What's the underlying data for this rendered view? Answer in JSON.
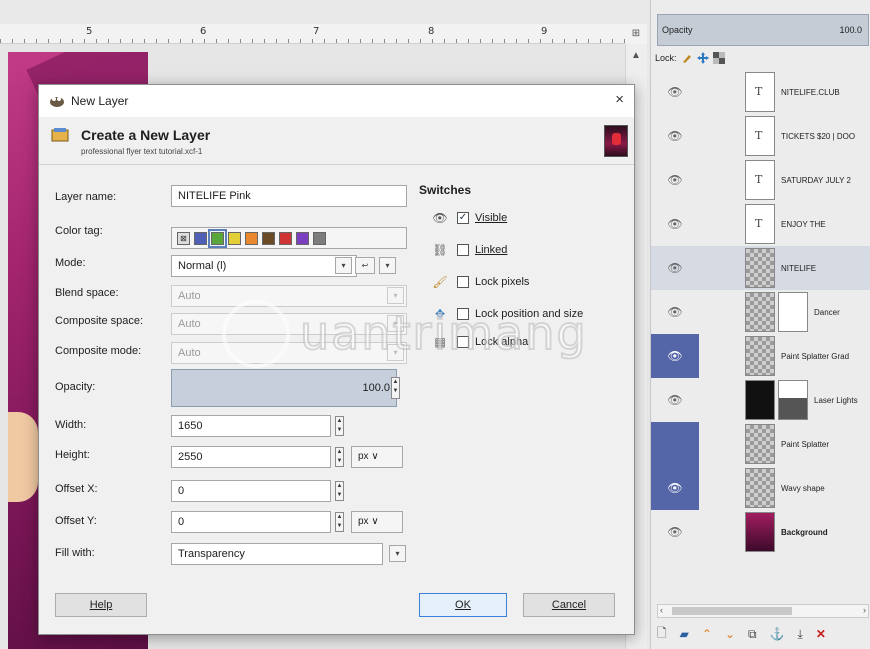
{
  "canvas": {
    "ruler_numbers": [
      "5",
      "6",
      "7",
      "8",
      "9"
    ],
    "corner_icon": "zoom-icon"
  },
  "layers_panel": {
    "opacity_label": "Opacity",
    "opacity_value": "100.0",
    "lock_label": "Lock:",
    "layers": [
      {
        "name": "NITELIFE.CLUB",
        "thumb": "text",
        "visible": true
      },
      {
        "name": "TICKETS $20 | DOO",
        "thumb": "text",
        "visible": true
      },
      {
        "name": "SATURDAY JULY 2",
        "thumb": "text",
        "visible": true
      },
      {
        "name": "ENJOY THE",
        "thumb": "text",
        "visible": true
      },
      {
        "name": "NITELIFE",
        "thumb": "checker",
        "visible": true,
        "selected": true
      },
      {
        "name": "Dancer",
        "thumb": "checker",
        "visible": true,
        "mask": true
      },
      {
        "name": "Paint Splatter Grad",
        "thumb": "checker",
        "visible": true
      },
      {
        "name": "Laser Lights",
        "thumb": "dark",
        "visible": true,
        "mask": true
      },
      {
        "name": "Paint Splatter",
        "thumb": "checker",
        "visible": true
      },
      {
        "name": "Wavy shape",
        "thumb": "checker",
        "visible": true
      },
      {
        "name": "Background",
        "thumb": "bg",
        "visible": true,
        "bold": true
      }
    ],
    "tool_icons": [
      "new-layer-icon",
      "new-layer-group-icon",
      "raise-layer-icon",
      "lower-layer-icon",
      "duplicate-layer-icon",
      "anchor-layer-icon",
      "merge-layer-icon",
      "delete-layer-icon"
    ]
  },
  "dialog": {
    "window_title": "New Layer",
    "close_label": "×",
    "header_title": "Create a New Layer",
    "header_subtitle": "professional flyer text tutorial.xcf-1",
    "labels": {
      "layer_name": "Layer name:",
      "color_tag": "Color tag:",
      "mode": "Mode:",
      "blend_space": "Blend space:",
      "composite_space": "Composite space:",
      "composite_mode": "Composite mode:",
      "opacity": "Opacity:",
      "width": "Width:",
      "height": "Height:",
      "offset_x": "Offset X:",
      "offset_y": "Offset Y:",
      "fill_with": "Fill with:"
    },
    "values": {
      "layer_name": "NITELIFE Pink",
      "mode": "Normal (l)",
      "blend_space": "Auto",
      "composite_space": "Auto",
      "composite_mode": "Auto",
      "opacity": "100.0",
      "width": "1650",
      "height": "2550",
      "offset_x": "0",
      "offset_y": "0",
      "fill_with": "Transparency",
      "unit_height": "px",
      "unit_offset": "px"
    },
    "color_tags": [
      {
        "name": "none",
        "color": "#dddddd"
      },
      {
        "name": "blue",
        "color": "#4f5fb5"
      },
      {
        "name": "green",
        "color": "#5aa63d"
      },
      {
        "name": "yellow",
        "color": "#e3cf38"
      },
      {
        "name": "orange",
        "color": "#e8882f"
      },
      {
        "name": "brown",
        "color": "#6b4a26"
      },
      {
        "name": "red",
        "color": "#cf3434"
      },
      {
        "name": "violet",
        "color": "#7b3fbf"
      },
      {
        "name": "gray",
        "color": "#7d7d7d"
      }
    ],
    "active_color_tag": "green",
    "switches_title": "Switches",
    "switches": [
      {
        "label": "Visible",
        "checked": true,
        "icon": "eye-icon"
      },
      {
        "label": "Linked",
        "checked": false,
        "icon": "chain-icon"
      },
      {
        "label": "Lock pixels",
        "checked": false,
        "icon": "paintbrush-icon"
      },
      {
        "label": "Lock position and size",
        "checked": false,
        "icon": "move-icon"
      },
      {
        "label": "Lock alpha",
        "checked": false,
        "icon": "checkerboard-icon"
      }
    ],
    "buttons": {
      "help": "Help",
      "ok": "OK",
      "cancel": "Cancel"
    }
  },
  "watermark": {
    "text": "uantrimang"
  }
}
